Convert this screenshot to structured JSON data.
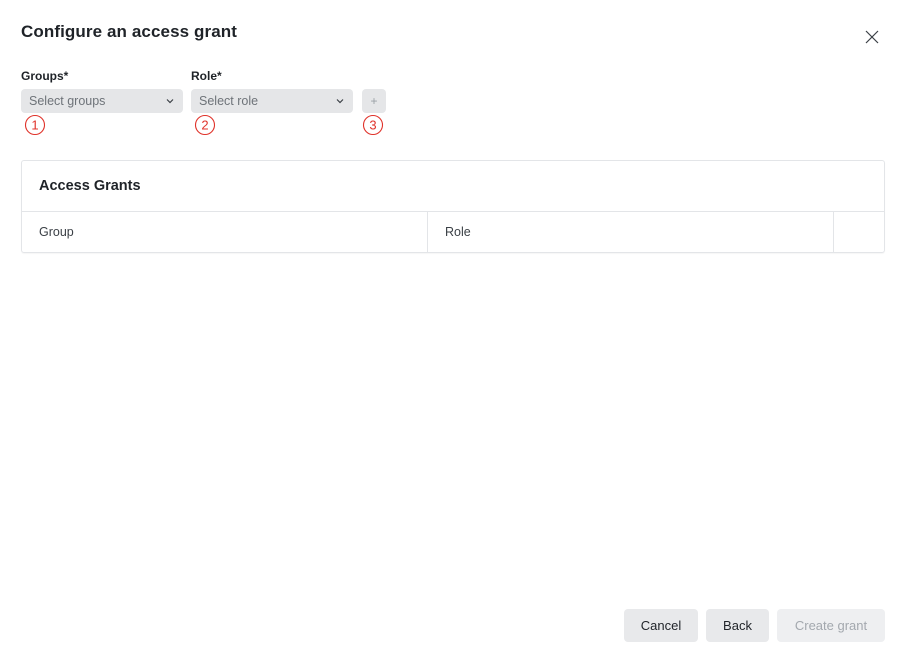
{
  "dialog": {
    "title": "Configure an access grant",
    "close_icon": "close-icon"
  },
  "form": {
    "groups": {
      "label": "Groups*",
      "placeholder": "Select groups",
      "icon": "chevron-down-icon",
      "marker": "①"
    },
    "role": {
      "label": "Role*",
      "placeholder": "Select role",
      "icon": "chevron-down-icon",
      "marker": "②"
    },
    "add": {
      "label": "+",
      "marker": "③"
    }
  },
  "grants_table": {
    "title": "Access Grants",
    "columns": [
      "Group",
      "Role",
      ""
    ],
    "rows": []
  },
  "footer": {
    "cancel_label": "Cancel",
    "back_label": "Back",
    "create_label": "Create grant",
    "create_disabled": true
  },
  "colors": {
    "annotation_red": "#e0332b",
    "control_bg": "#e5e6e8",
    "text_primary": "#1f2328",
    "text_muted": "#6e7379",
    "border": "#e3e5e8"
  }
}
